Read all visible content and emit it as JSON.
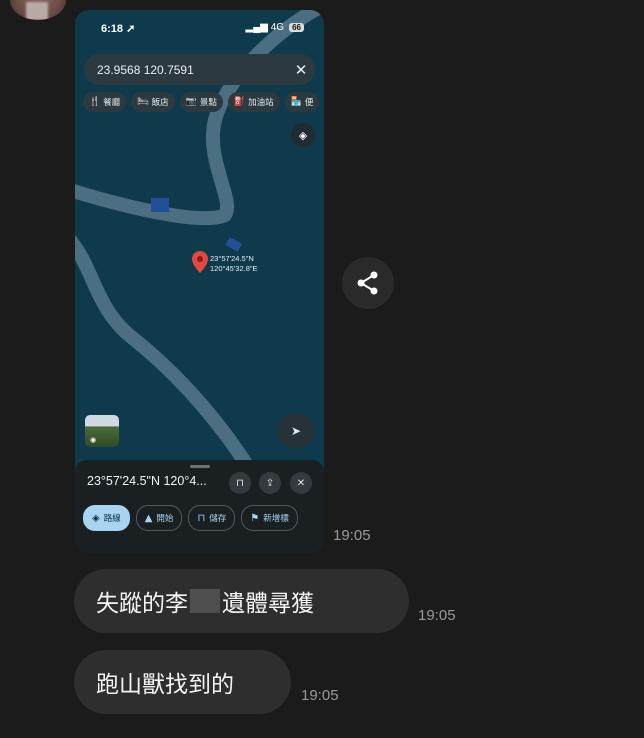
{
  "phone": {
    "status_time": "6:18 ➚",
    "status_signal": "▂▄▆ 4G",
    "status_battery": "66",
    "search_value": "23.9568 120.7591",
    "chips": [
      {
        "icon": "🍴",
        "label": "餐廳"
      },
      {
        "icon": "🛏",
        "label": "飯店"
      },
      {
        "icon": "📷",
        "label": "景點"
      },
      {
        "icon": "⛽",
        "label": "加油站"
      },
      {
        "icon": "🏪",
        "label": "便"
      }
    ],
    "pin_lat": "23°57'24.5\"N",
    "pin_lng": "120°45'32.8\"E",
    "sheet_title": "23°57'24.5\"N 120°4...",
    "actions": [
      {
        "icon": "◈",
        "label": "路線"
      },
      {
        "icon": "▲",
        "label": "開始"
      },
      {
        "icon": "⊓",
        "label": "儲存"
      },
      {
        "icon": "⚑",
        "label": "新增標"
      }
    ]
  },
  "messages": [
    {
      "time": "19:05"
    },
    {
      "text_before": "失蹤的李",
      "text_after": "遺體尋獲",
      "time": "19:05"
    },
    {
      "text": "跑山獸找到的",
      "time": "19:05"
    }
  ],
  "colors": {
    "chat_bg": "#1b1b1b",
    "bubble": "#2e2e2e",
    "map_water": "#0e3a4b",
    "road": "#4b6e80",
    "pin": "#e5483f",
    "accent": "#a8d4f2"
  },
  "icons": {
    "share": "share-icon",
    "layers": "layers-icon",
    "navigation": "navigation-arrow-icon",
    "close": "close-icon",
    "pin": "map-pin-icon"
  }
}
